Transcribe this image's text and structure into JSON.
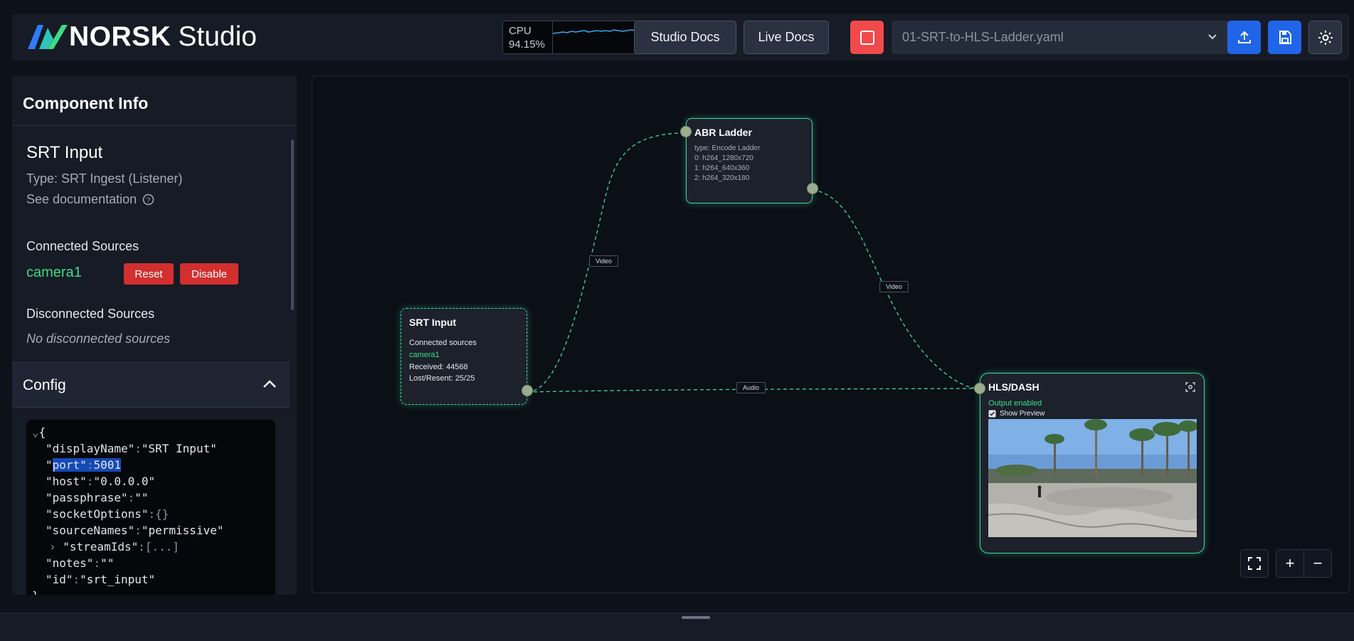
{
  "header": {
    "brand": "NORSK",
    "brand_suffix": "Studio",
    "cpu_label": "CPU",
    "cpu_value": "94.15%",
    "studio_docs": "Studio Docs",
    "live_docs": "Live Docs",
    "file_select": "01-SRT-to-HLS-Ladder.yaml",
    "icons": [
      "upload-icon",
      "save-icon",
      "gear-icon"
    ]
  },
  "panel": {
    "title": "Component Info",
    "component_name": "SRT Input",
    "component_type": "Type: SRT Ingest (Listener)",
    "see_documentation": "See documentation",
    "connected_title": "Connected Sources",
    "connected_source": "camera1",
    "reset": "Reset",
    "disable": "Disable",
    "disconnected_title": "Disconnected Sources",
    "no_disconnected": "No disconnected sources",
    "config_title": "Config"
  },
  "config": {
    "open": "{",
    "displayName_key": "\"displayName\"",
    "displayName_val": "\"SRT Input\"",
    "port_key": "port",
    "port_val": "5001",
    "host_key": "\"host\"",
    "host_val": "\"0.0.0.0\"",
    "passphrase_key": "\"passphrase\"",
    "passphrase_val": "\"\"",
    "socketOptions_key": "\"socketOptions\"",
    "socketOptions_val": "{}",
    "sourceNames_key": "\"sourceNames\"",
    "sourceNames_val": "\"permissive\"",
    "streamIds_key": "\"streamIds\"",
    "streamIds_val": "[...]",
    "notes_key": "\"notes\"",
    "notes_val": "\"\"",
    "id_key": "\"id\"",
    "id_val": "\"srt_input\"",
    "close": "}"
  },
  "nodes": {
    "srt": {
      "title": "SRT Input",
      "connected_label": "Connected sources",
      "source": "camera1",
      "received": "Received: 44568",
      "lost": "Lost/Resent: 25/25"
    },
    "abr": {
      "title": "ABR Ladder",
      "type": "type: Encode Ladder",
      "r0": "0: h264_1280x720",
      "r1": "1: h264_640x360",
      "r2": "2: h264_320x180"
    },
    "hls": {
      "title": "HLS/DASH",
      "status": "Output enabled",
      "preview_label": "Show Preview"
    }
  },
  "edges": {
    "video1": "Video",
    "video2": "Video",
    "audio": "Audio"
  },
  "colors": {
    "accent": "#3ddc9a",
    "source_green": "#3ddc84",
    "danger": "#d22f2f",
    "primary": "#2064e8"
  }
}
